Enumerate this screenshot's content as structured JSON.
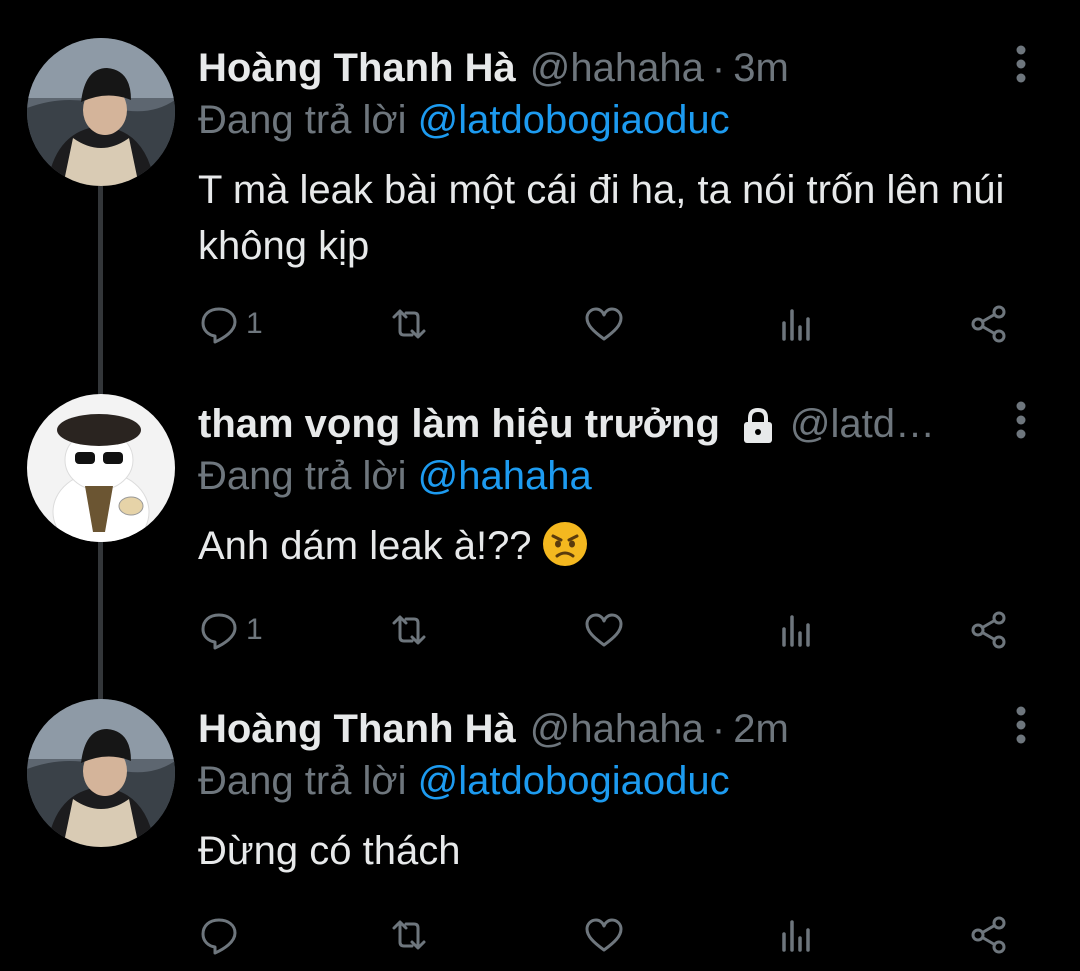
{
  "tweets": [
    {
      "name": "Hoàng Thanh Hà",
      "handle": "@hahaha",
      "separator": "·",
      "time": "3m",
      "reply_prefix": "Đang trả lời",
      "reply_to": "@latdobogiaoduc",
      "text": "T mà leak bài một cái đi ha, ta nói trốn lên núi không kịp",
      "reply_count": "1",
      "avatar": "avatar-man-beanie"
    },
    {
      "name": "tham vọng làm hiệu trưởng",
      "handle": "@latd…",
      "locked": true,
      "reply_prefix": "Đang trả lời",
      "reply_to": "@hahaha",
      "text": "Anh dám leak à!??",
      "emoji": "angry-face-emoji",
      "reply_count": "1",
      "avatar": "avatar-cat-sunglasses"
    },
    {
      "name": "Hoàng Thanh Hà",
      "handle": "@hahaha",
      "separator": "·",
      "time": "2m",
      "reply_prefix": "Đang trả lời",
      "reply_to": "@latdobogiaoduc",
      "text": "Đừng có thách",
      "reply_count": "",
      "avatar": "avatar-man-beanie"
    }
  ],
  "icons": [
    "reply-icon",
    "retweet-icon",
    "like-icon",
    "analytics-icon",
    "share-icon",
    "more-options-icon",
    "lock-icon"
  ],
  "colors": {
    "background": "#000000",
    "text": "#e7e9ea",
    "muted": "#6e767d",
    "link": "#1d9bf0",
    "thread_line": "#333639"
  }
}
